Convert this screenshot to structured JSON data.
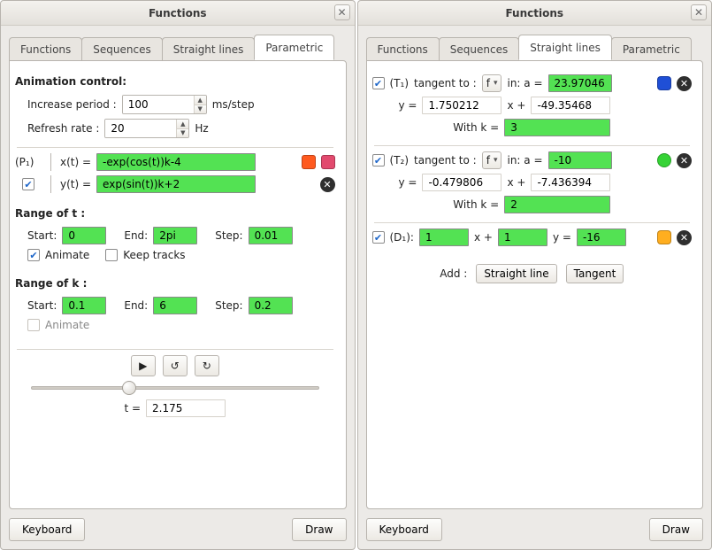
{
  "left": {
    "title": "Functions",
    "tabs": [
      "Functions",
      "Sequences",
      "Straight lines",
      "Parametric"
    ],
    "active_tab": "Parametric",
    "anim_section": "Animation control:",
    "increase_label": "Increase period :",
    "increase_val": "100",
    "increase_unit": "ms/step",
    "refresh_label": "Refresh rate :",
    "refresh_val": "20",
    "refresh_unit": "Hz",
    "p1_label": "(P₁)",
    "x_lhs": "x(t) =",
    "x_expr": "-exp(cos(t))k-4",
    "y_lhs": "y(t) =",
    "y_expr": "exp(sin(t))k+2",
    "range_t": "Range of t :",
    "t_start_lbl": "Start:",
    "t_start": "0",
    "t_end_lbl": "End:",
    "t_end": "2pi",
    "t_step_lbl": "Step:",
    "t_step": "0.01",
    "animate_lbl": "Animate",
    "keeptracks_lbl": "Keep tracks",
    "range_k": "Range of k :",
    "k_start": "0.1",
    "k_end": "6",
    "k_step": "0.2",
    "t_disp_lbl": "t =",
    "t_disp_val": "2.175",
    "slider_frac": 0.34,
    "swatch1": "#ff5a1f",
    "swatch2": "#e24a6e",
    "keyboard": "Keyboard",
    "draw": "Draw"
  },
  "right": {
    "title": "Functions",
    "tabs": [
      "Functions",
      "Sequences",
      "Straight lines",
      "Parametric"
    ],
    "active_tab": "Straight lines",
    "t1_label": "(T₁)",
    "t2_label": "(T₂)",
    "d1_label": "(D₁):",
    "tangent_to": "tangent to :",
    "in_a": "in: a =",
    "f_option": "f",
    "t1_a": "23.97046",
    "t2_a": "-10",
    "y_eq": "y =",
    "x_plus": "x +",
    "t1_slope": "1.750212",
    "t1_intercept": "-49.35468",
    "t2_slope": "-0.479806",
    "t2_intercept": "-7.436394",
    "withk": "With k =",
    "t1_k": "3",
    "t2_k": "2",
    "d1_a": "1",
    "d1_b": "1",
    "d1_y": "-16",
    "c_blue": "#1f4fd6",
    "c_green": "#35d335",
    "c_orange": "#ffae1f",
    "add_lbl": "Add :",
    "add_sl": "Straight line",
    "add_tan": "Tangent",
    "keyboard": "Keyboard",
    "draw": "Draw"
  }
}
